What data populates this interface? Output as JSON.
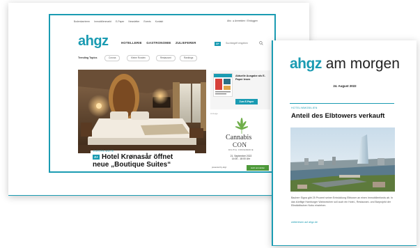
{
  "desktop": {
    "topnav": [
      "Bodenkarrieren",
      "Immobilienmarkt",
      "E-Paper",
      "Newsletter",
      "Events",
      "Kontakt"
    ],
    "topnav_right": [
      "Abo",
      "Anmelden / Einloggen"
    ],
    "logo": "ahgz",
    "categories": [
      "HOTELLERIE",
      "GASTRONOMIE",
      "ZULIEFERER"
    ],
    "plus_badge": "A+",
    "search_placeholder": "Suchbegriff eingeben",
    "trending_label": "Trending Topics",
    "trending_pills": [
      "Corona",
      "Kleine Runden",
      "Restaurant",
      "Rankings"
    ],
    "hero": {
      "kicker": "EUROPA-WEITE",
      "plus_badge": "A+",
      "headline_line1": "Hotel Krønasår öffnet",
      "headline_line2": "neue „Boutique Suites“"
    },
    "ad_top": {
      "title": "Aktuelle Ausgabe als E-Paper lesen",
      "button": "Zum E-Paper"
    },
    "ad_label": "Anzeige",
    "ad_cannabis": {
      "title": "Cannabis",
      "title2": "CON",
      "subtitle": "DIGITAL CONFERENCE",
      "date_line1": "21. September 2022",
      "date_line2": "14:00 - 18:00 Uhr",
      "row": "presented by ahgz",
      "button": "Jetzt anmelden"
    }
  },
  "newsletter": {
    "logo_brand": "ahgz",
    "logo_suffix": "am morgen",
    "date": "24. August 2022",
    "kicker": "HOTELIMMOBILIEN",
    "headline": "Anteil des Elbtowers verkauft",
    "body": "Bauherr Signa gibt 25 Prozent seiner Entwicklung Elbtower an einen Immobilienfonds ab. In das künftige Hamburger Wahrzeichen soll auch ein Hotel-, Restaurant- und Barprojekt der Elbstädtischen Nobu einziehen.",
    "link": "weiterlesen auf ahgz.de"
  },
  "colors": {
    "accent": "#1a9bb2",
    "cta_green": "#4e9a3a"
  }
}
